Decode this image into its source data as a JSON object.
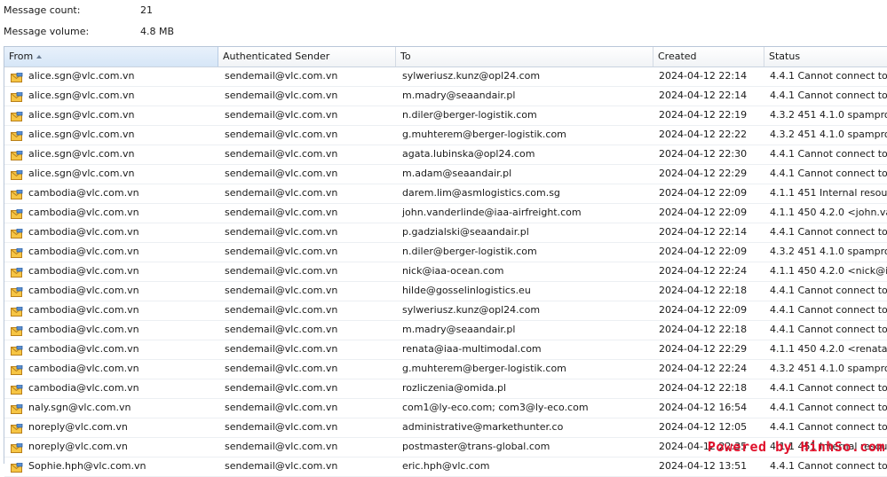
{
  "summary": {
    "count_label": "Message count:",
    "count_value": "21",
    "volume_label": "Message volume:",
    "volume_value": "4.8 MB"
  },
  "columns": {
    "from": "From",
    "auth": "Authenticated Sender",
    "to": "To",
    "created": "Created",
    "status": "Status"
  },
  "rows": [
    {
      "from": "alice.sgn@vlc.com.vn",
      "auth": "sendemail@vlc.com.vn",
      "to": "sylweriusz.kunz@opl24.com",
      "created": "2024-04-12 22:14",
      "status": "4.4.1 Cannot connect to"
    },
    {
      "from": "alice.sgn@vlc.com.vn",
      "auth": "sendemail@vlc.com.vn",
      "to": "m.madry@seaandair.pl",
      "created": "2024-04-12 22:14",
      "status": "4.4.1 Cannot connect to"
    },
    {
      "from": "alice.sgn@vlc.com.vn",
      "auth": "sendemail@vlc.com.vn",
      "to": "n.diler@berger-logistik.com",
      "created": "2024-04-12 22:19",
      "status": "4.3.2 451 4.1.0 spampro"
    },
    {
      "from": "alice.sgn@vlc.com.vn",
      "auth": "sendemail@vlc.com.vn",
      "to": "g.muhterem@berger-logistik.com",
      "created": "2024-04-12 22:22",
      "status": "4.3.2 451 4.1.0 spampro"
    },
    {
      "from": "alice.sgn@vlc.com.vn",
      "auth": "sendemail@vlc.com.vn",
      "to": "agata.lubinska@opl24.com",
      "created": "2024-04-12 22:30",
      "status": "4.4.1 Cannot connect to"
    },
    {
      "from": "alice.sgn@vlc.com.vn",
      "auth": "sendemail@vlc.com.vn",
      "to": "m.adam@seaandair.pl",
      "created": "2024-04-12 22:29",
      "status": "4.4.1 Cannot connect to"
    },
    {
      "from": "cambodia@vlc.com.vn",
      "auth": "sendemail@vlc.com.vn",
      "to": "darem.lim@asmlogistics.com.sg",
      "created": "2024-04-12 22:09",
      "status": "4.1.1 451 Internal resou"
    },
    {
      "from": "cambodia@vlc.com.vn",
      "auth": "sendemail@vlc.com.vn",
      "to": "john.vanderlinde@iaa-airfreight.com",
      "created": "2024-04-12 22:09",
      "status": "4.1.1 450 4.2.0 <john.va"
    },
    {
      "from": "cambodia@vlc.com.vn",
      "auth": "sendemail@vlc.com.vn",
      "to": "p.gadzialski@seaandair.pl",
      "created": "2024-04-12 22:14",
      "status": "4.4.1 Cannot connect to"
    },
    {
      "from": "cambodia@vlc.com.vn",
      "auth": "sendemail@vlc.com.vn",
      "to": "n.diler@berger-logistik.com",
      "created": "2024-04-12 22:09",
      "status": "4.3.2 451 4.1.0 spampro"
    },
    {
      "from": "cambodia@vlc.com.vn",
      "auth": "sendemail@vlc.com.vn",
      "to": "nick@iaa-ocean.com",
      "created": "2024-04-12 22:24",
      "status": "4.1.1 450 4.2.0 <nick@i"
    },
    {
      "from": "cambodia@vlc.com.vn",
      "auth": "sendemail@vlc.com.vn",
      "to": "hilde@gosselinlogistics.eu",
      "created": "2024-04-12 22:18",
      "status": "4.4.1 Cannot connect to"
    },
    {
      "from": "cambodia@vlc.com.vn",
      "auth": "sendemail@vlc.com.vn",
      "to": "sylweriusz.kunz@opl24.com",
      "created": "2024-04-12 22:09",
      "status": "4.4.1 Cannot connect to"
    },
    {
      "from": "cambodia@vlc.com.vn",
      "auth": "sendemail@vlc.com.vn",
      "to": "m.madry@seaandair.pl",
      "created": "2024-04-12 22:18",
      "status": "4.4.1 Cannot connect to"
    },
    {
      "from": "cambodia@vlc.com.vn",
      "auth": "sendemail@vlc.com.vn",
      "to": "renata@iaa-multimodal.com",
      "created": "2024-04-12 22:29",
      "status": "4.1.1 450 4.2.0 <renata"
    },
    {
      "from": "cambodia@vlc.com.vn",
      "auth": "sendemail@vlc.com.vn",
      "to": "g.muhterem@berger-logistik.com",
      "created": "2024-04-12 22:24",
      "status": "4.3.2 451 4.1.0 spampro"
    },
    {
      "from": "cambodia@vlc.com.vn",
      "auth": "sendemail@vlc.com.vn",
      "to": "rozliczenia@omida.pl",
      "created": "2024-04-12 22:18",
      "status": "4.4.1 Cannot connect to"
    },
    {
      "from": "naly.sgn@vlc.com.vn",
      "auth": "sendemail@vlc.com.vn",
      "to": "com1@ly-eco.com; com3@ly-eco.com",
      "created": "2024-04-12 16:54",
      "status": "4.4.1 Cannot connect to"
    },
    {
      "from": "noreply@vlc.com.vn",
      "auth": "sendemail@vlc.com.vn",
      "to": "administrative@markethunter.co",
      "created": "2024-04-12 12:05",
      "status": "4.4.1 Cannot connect to"
    },
    {
      "from": "noreply@vlc.com.vn",
      "auth": "sendemail@vlc.com.vn",
      "to": "postmaster@trans-global.com",
      "created": "2024-04-12 22:35",
      "status": "4.1.1 451 Internal resou"
    },
    {
      "from": "Sophie.hph@vlc.com.vn",
      "auth": "sendemail@vlc.com.vn",
      "to": "eric.hph@vlc.com",
      "created": "2024-04-12 13:51",
      "status": "4.4.1 Cannot connect to"
    }
  ],
  "watermark": "Powered by HinhSo.com",
  "icon": "mail-envelope-icon",
  "colors": {
    "header_border": "#b9c7d9",
    "sorted_header": "#d6e6f7",
    "watermark": "#e0102b"
  }
}
